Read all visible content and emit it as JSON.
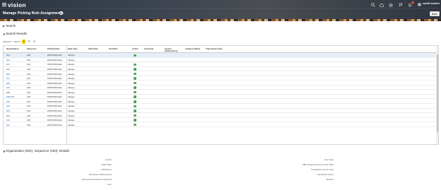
{
  "app": {
    "logo": "vision",
    "page_title": "Manage Picking Rule Assignments",
    "user_name": "sam40 student",
    "notification_count": "6",
    "done_label": "Done",
    "help_glyph": "?"
  },
  "sections": {
    "search": "Search",
    "search_results": "Search Results"
  },
  "toolbar": {
    "actions_label": "Actions ▾",
    "view_label": "View ▾"
  },
  "table": {
    "columns": [
      "Organization",
      "Sequence",
      "Picking Rule",
      "Date Type",
      "Start Date",
      "End Date",
      "Active",
      "Customer",
      "Source Subinventory",
      "Category Name",
      "Transaction Type"
    ],
    "rows": [
      {
        "org": "002",
        "seq": "100",
        "rule": "DSPICKRULE1",
        "date_type": "Always",
        "active": true
      },
      {
        "org": "003",
        "seq": "100",
        "rule": "DSPICKRULE1",
        "date_type": "Always",
        "active": false
      },
      {
        "org": "201",
        "seq": "100",
        "rule": "DSPICKRULE1",
        "date_type": "Always",
        "active": true
      },
      {
        "org": "204",
        "seq": "100",
        "rule": "DSPICKRULE1",
        "date_type": "Always",
        "active": true
      },
      {
        "org": "005",
        "seq": "100",
        "rule": "DSPICKRULE1",
        "date_type": "Always",
        "active": true
      },
      {
        "org": "101",
        "seq": "100",
        "rule": "DSPICKRULE1",
        "date_type": "Always",
        "active": true
      },
      {
        "org": "006",
        "seq": "100",
        "rule": "DSPICKRULE1",
        "date_type": "Always",
        "active": true
      },
      {
        "org": "101",
        "seq": "100",
        "rule": "DSPICKRULE1",
        "date_type": "Always",
        "active": true
      },
      {
        "org": "008",
        "seq": "100",
        "rule": "DSPICKRULE1",
        "date_type": "Always",
        "active": true
      },
      {
        "org": "PROJ01",
        "seq": "100",
        "rule": "DSPICKRULE1",
        "date_type": "Always",
        "active": true
      },
      {
        "org": "102",
        "seq": "100",
        "rule": "DSPICKRULE1",
        "date_type": "Always",
        "active": true
      },
      {
        "org": "103",
        "seq": "100",
        "rule": "DSPICKRULE1",
        "date_type": "Always",
        "active": true
      },
      {
        "org": "003",
        "seq": "100",
        "rule": "DSPICKRULE1",
        "date_type": "Always",
        "active": true
      },
      {
        "org": "004",
        "seq": "100",
        "rule": "DSPICKRULE1",
        "date_type": "Always",
        "active": true
      },
      {
        "org": "102",
        "seq": "100",
        "rule": "DSPICKRULE1",
        "date_type": "Always",
        "active": true
      },
      {
        "org": "011",
        "seq": "100",
        "rule": "DSPICKRULE1",
        "date_type": "Always",
        "active": true
      }
    ]
  },
  "details": {
    "title": "Organization (002), Sequence (100): Details",
    "left_labels": [
      "Carrier",
      "UOM Class",
      "UOM Name",
      "Destination Subinventory",
      "Movement Requests Created By",
      "Item"
    ],
    "right_labels": [
      "Item Type",
      "ABC Assignment Group and Class",
      "Transaction Source Type",
      "Transaction Action",
      "Reason"
    ]
  },
  "colors": {
    "header_dark": "#2c343f",
    "link_blue": "#1a64a8",
    "active_green": "#3f9b3f",
    "selected_row": "#e4eff9",
    "add_button_yellow": "#f2d400"
  }
}
